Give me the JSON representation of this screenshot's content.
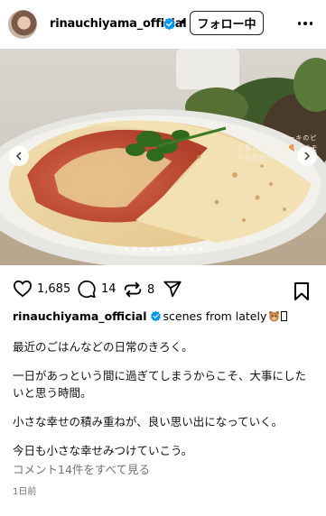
{
  "header": {
    "username": "rinauchiyama_official",
    "separator": "•",
    "follow_label": "フォロー中"
  },
  "media": {
    "overlay_text": "オランダパンケーキのピザ風バージョン🍕モチモチの生地が堪らない！",
    "carousel": {
      "total": 10,
      "active_index": 3
    }
  },
  "actions": {
    "likes": "1,685",
    "comments": "14",
    "reposts": "8"
  },
  "caption": {
    "username": "rinauchiyama_official",
    "text": "scenes from lately",
    "lines": [
      "最近のごはんなどの日常のきろく。",
      "一日があっという間に過ぎてしまうからこそ、大事にしたいと思う時間。",
      "小さな幸せの積み重ねが、良い思い出になっていく。",
      "今日も小さな幸せみつけていこう。"
    ]
  },
  "comments_link": "コメント14件をすべて見る",
  "timestamp": "1日前",
  "colors": {
    "verified": "#0095f6",
    "muted": "#737373"
  }
}
